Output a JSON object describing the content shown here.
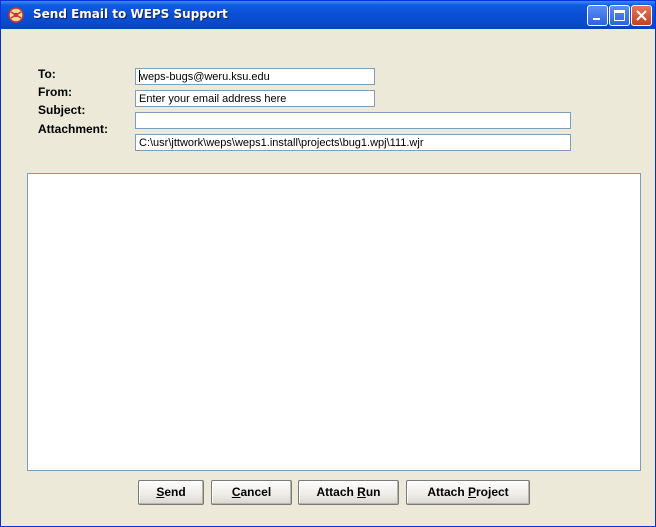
{
  "window": {
    "title": "Send Email to WEPS Support"
  },
  "form": {
    "to_label": "To:",
    "from_label": "From:",
    "subject_label": "Subject:",
    "attachment_label": "Attachment:",
    "to_value": "weps-bugs@weru.ksu.edu",
    "from_value": "Enter your email address here",
    "subject_value": "",
    "attachment_value": "C:\\usr\\jttwork\\weps\\weps1.install\\projects\\bug1.wpj\\111.wjr",
    "message_body": ""
  },
  "buttons": {
    "send": {
      "pre": "",
      "mnemonic": "S",
      "post": "end"
    },
    "cancel": {
      "pre": "",
      "mnemonic": "C",
      "post": "ancel"
    },
    "attach_run": {
      "pre": "Attach ",
      "mnemonic": "R",
      "post": "un"
    },
    "attach_project": {
      "pre": "Attach ",
      "mnemonic": "P",
      "post": "roject"
    }
  },
  "colors": {
    "titlebar": "#0a4fd5",
    "window_bg": "#ece9d8",
    "field_border": "#7f9db9"
  }
}
